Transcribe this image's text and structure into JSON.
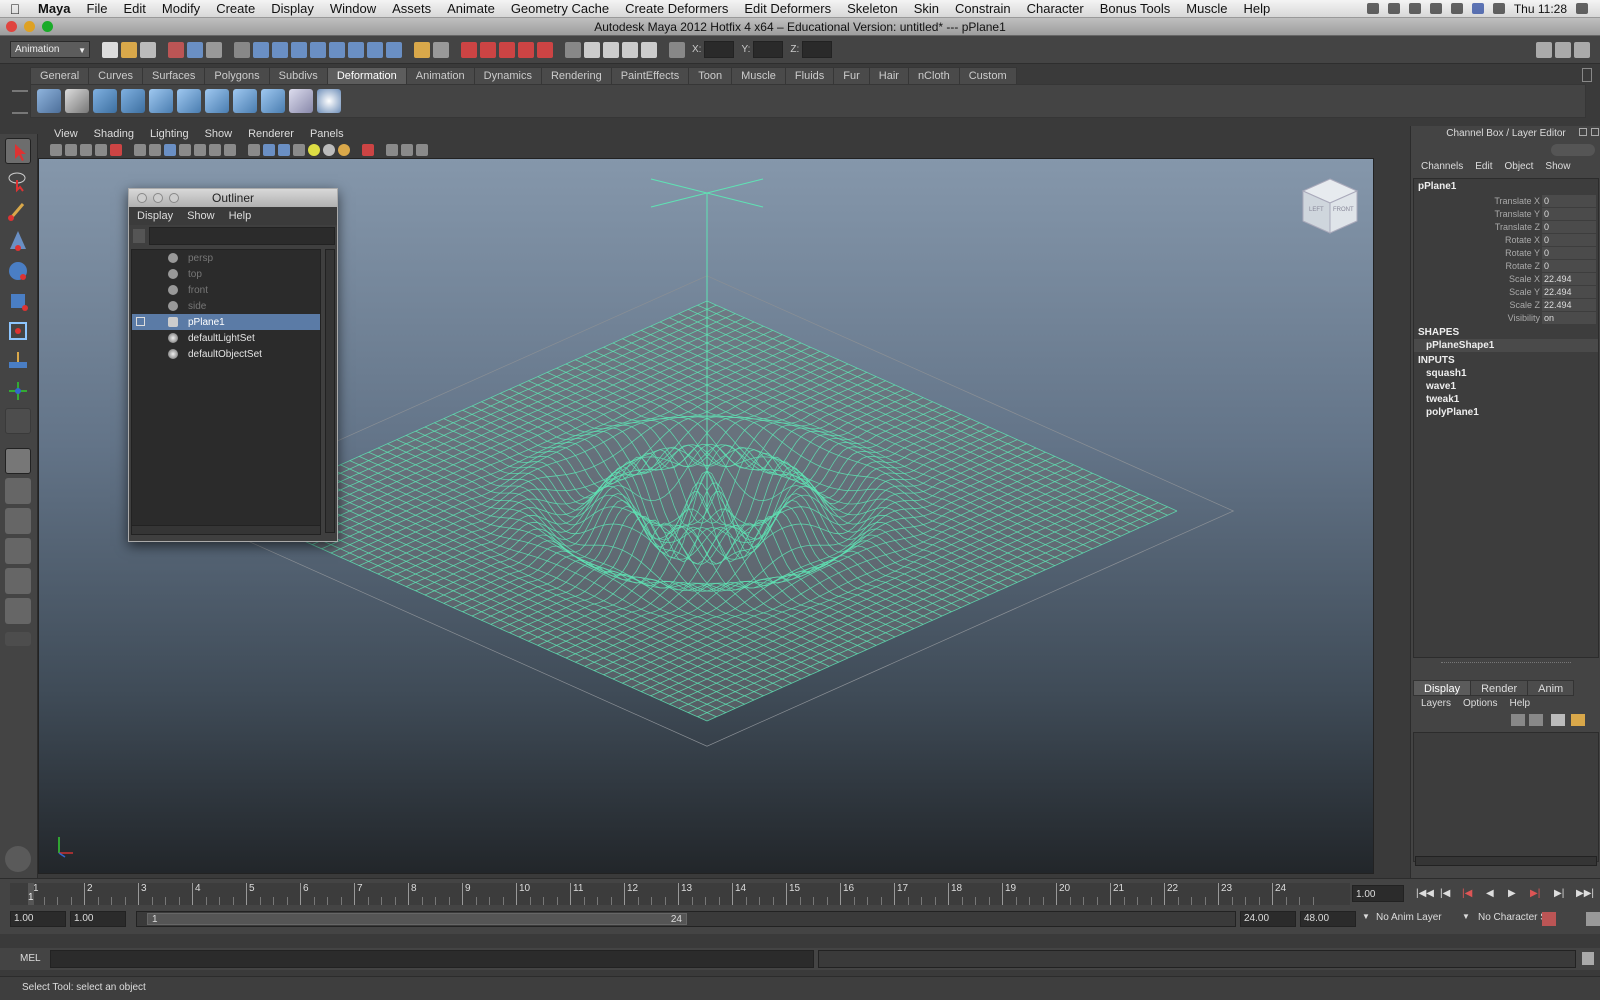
{
  "mac_menu": {
    "items": [
      "Maya",
      "File",
      "Edit",
      "Modify",
      "Create",
      "Display",
      "Window",
      "Assets",
      "Animate",
      "Geometry Cache",
      "Create Deformers",
      "Edit Deformers",
      "Skeleton",
      "Skin",
      "Constrain",
      "Character",
      "Bonus Tools",
      "Muscle",
      "Help"
    ],
    "clock": "Thu 11:28"
  },
  "window_title": "Autodesk Maya 2012 Hotfix 4 x64 – Educational Version: untitled*   ---   pPlane1",
  "status_line": {
    "menu_set": "Animation",
    "x_label": "X:",
    "y_label": "Y:",
    "z_label": "Z:"
  },
  "shelf": {
    "tabs": [
      "General",
      "Curves",
      "Surfaces",
      "Polygons",
      "Subdivs",
      "Deformation",
      "Animation",
      "Dynamics",
      "Rendering",
      "PaintEffects",
      "Toon",
      "Muscle",
      "Fluids",
      "Fur",
      "Hair",
      "nCloth",
      "Custom"
    ],
    "active_tab": "Deformation"
  },
  "panel_menu": [
    "View",
    "Shading",
    "Lighting",
    "Show",
    "Renderer",
    "Panels"
  ],
  "viewcube": {
    "left": "LEFT",
    "front": "FRONT"
  },
  "outliner": {
    "title": "Outliner",
    "menu": [
      "Display",
      "Show",
      "Help"
    ],
    "items": [
      {
        "label": "persp"
      },
      {
        "label": "top"
      },
      {
        "label": "front"
      },
      {
        "label": "side"
      },
      {
        "label": "pPlane1"
      },
      {
        "label": "defaultLightSet"
      },
      {
        "label": "defaultObjectSet"
      }
    ]
  },
  "channel_box": {
    "title": "Channel Box / Layer Editor",
    "menu": [
      "Channels",
      "Edit",
      "Object",
      "Show"
    ],
    "object": "pPlane1",
    "attributes": [
      {
        "label": "Translate X",
        "value": "0"
      },
      {
        "label": "Translate Y",
        "value": "0"
      },
      {
        "label": "Translate Z",
        "value": "0"
      },
      {
        "label": "Rotate X",
        "value": "0"
      },
      {
        "label": "Rotate Y",
        "value": "0"
      },
      {
        "label": "Rotate Z",
        "value": "0"
      },
      {
        "label": "Scale X",
        "value": "22.494"
      },
      {
        "label": "Scale Y",
        "value": "22.494"
      },
      {
        "label": "Scale Z",
        "value": "22.494"
      },
      {
        "label": "Visibility",
        "value": "on"
      }
    ],
    "shapes_label": "SHAPES",
    "shape": "pPlaneShape1",
    "inputs_label": "INPUTS",
    "inputs": [
      "squash1",
      "wave1",
      "tweak1",
      "polyPlane1"
    ]
  },
  "layer_editor": {
    "tabs": [
      "Display",
      "Render",
      "Anim"
    ],
    "menu": [
      "Layers",
      "Options",
      "Help"
    ]
  },
  "timeline": {
    "ticks": [
      "1",
      "2",
      "3",
      "4",
      "5",
      "6",
      "7",
      "8",
      "9",
      "10",
      "11",
      "12",
      "13",
      "14",
      "15",
      "16",
      "17",
      "18",
      "19",
      "20",
      "21",
      "22",
      "23",
      "24"
    ],
    "current_frame_marker": "1",
    "current_time": "1.00"
  },
  "range": {
    "start": "1.00",
    "playback_start": "1.00",
    "slider_start": "1",
    "slider_end": "24",
    "playback_end": "24.00",
    "end": "48.00",
    "anim_layer": "No Anim Layer",
    "char_set": "No Character Set"
  },
  "mel_label": "MEL",
  "help_line": "Select Tool: select an object"
}
